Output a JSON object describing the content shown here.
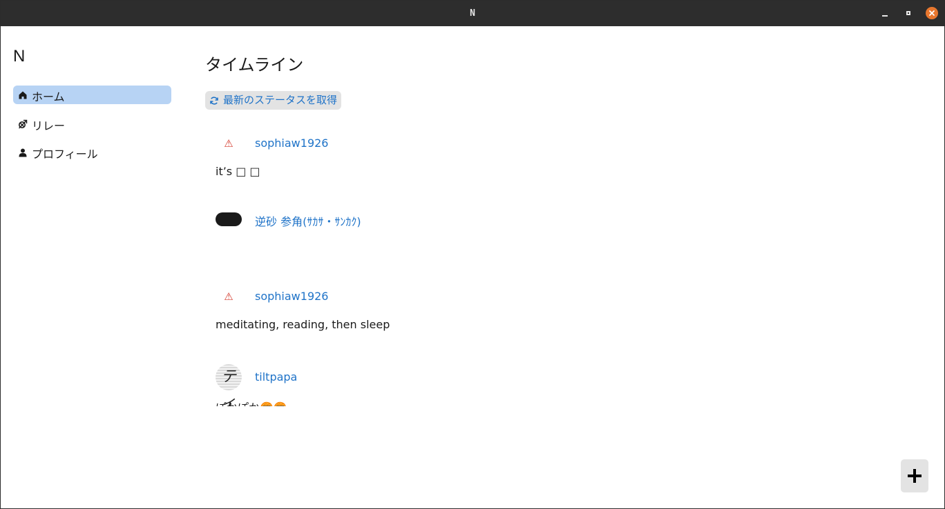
{
  "window": {
    "title": "N"
  },
  "sidebar": {
    "app_name": "N",
    "items": [
      {
        "label": "ホーム",
        "icon": "home-icon",
        "active": true
      },
      {
        "label": "リレー",
        "icon": "relay-icon",
        "active": false
      },
      {
        "label": "プロフィール",
        "icon": "person-icon",
        "active": false
      }
    ]
  },
  "main": {
    "title": "タイムライン",
    "refresh_label": "最新のステータスを取得",
    "posts": [
      {
        "author": "sophiaw1926",
        "avatar": "warning-icon",
        "avatar_text": "⚠",
        "content": "it’s □ □"
      },
      {
        "author": "逆砂 参角(ｻｶｻ・ｻﾝｶｸ)",
        "avatar": "pill-avatar",
        "content": ""
      },
      {
        "author": "sophiaw1926",
        "avatar": "warning-icon",
        "avatar_text": "⚠",
        "content": "meditating, reading, then sleep"
      },
      {
        "author": "tiltpapa",
        "avatar": "round-avatar",
        "avatar_text": "ティ",
        "content": "ぽかぽか🍘🍘"
      }
    ]
  },
  "colors": {
    "titlebar": "#2d2d2d",
    "accent": "#1f73c8",
    "active_nav": "#b7d3f4",
    "close_button": "#e8772e",
    "warning": "#d43a2c"
  }
}
